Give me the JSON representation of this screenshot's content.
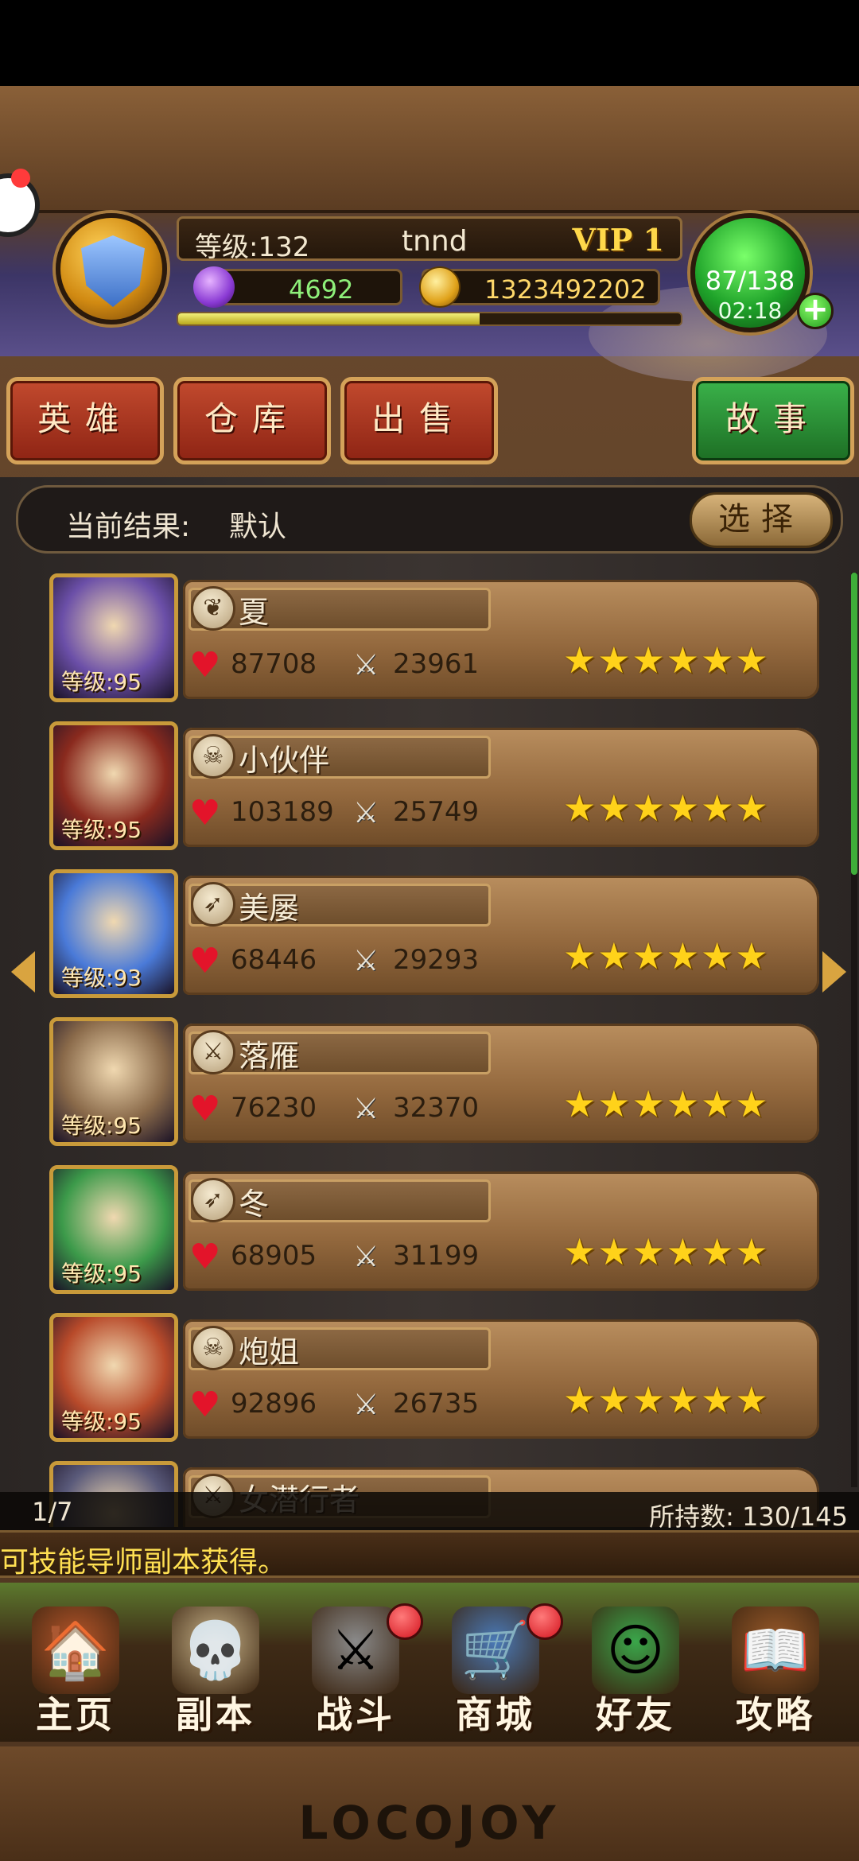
{
  "player": {
    "level_label": "等级:132",
    "name": "tnnd",
    "vip": "VIP 1",
    "gems": "4692",
    "coins": "1323492202",
    "energy": "87/138",
    "energy_timer": "02:18",
    "exp_fraction": 0.6
  },
  "tabs": {
    "heroes": "英雄",
    "warehouse": "仓库",
    "sell": "出售",
    "story": "故事"
  },
  "filter": {
    "label": "当前结果:",
    "value": "默认",
    "select_button": "选择"
  },
  "heroes": [
    {
      "name": "夏",
      "level": "等级:95",
      "hp": "87708",
      "atk": "23961",
      "stars": "★★★★★★",
      "class_icon": "leaf-icon",
      "portrait_color": "#6b4fa8"
    },
    {
      "name": "小伙伴",
      "level": "等级:95",
      "hp": "103189",
      "atk": "25749",
      "stars": "★★★★★★",
      "class_icon": "skull-icon",
      "portrait_color": "#8a2a1e"
    },
    {
      "name": "美屡",
      "level": "等级:93",
      "hp": "68446",
      "atk": "29293",
      "stars": "★★★★★★",
      "class_icon": "bow-icon",
      "portrait_color": "#4a7ad8"
    },
    {
      "name": "落雁",
      "level": "等级:95",
      "hp": "76230",
      "atk": "32370",
      "stars": "★★★★★★",
      "class_icon": "swords-icon",
      "portrait_color": "#8a6a4a"
    },
    {
      "name": "冬",
      "level": "等级:95",
      "hp": "68905",
      "atk": "31199",
      "stars": "★★★★★★",
      "class_icon": "bow-icon",
      "portrait_color": "#3c9a4a"
    },
    {
      "name": "炮姐",
      "level": "等级:95",
      "hp": "92896",
      "atk": "26735",
      "stars": "★★★★★★",
      "class_icon": "skull-icon",
      "portrait_color": "#b84a2a"
    },
    {
      "name": "女潜行者",
      "level": "",
      "hp": "",
      "atk": "",
      "stars": "",
      "class_icon": "swords-icon",
      "portrait_color": "#5a5a7a"
    }
  ],
  "footer": {
    "page": "1/7",
    "owned": "所持数: 130/145",
    "ticker": "可技能导师副本获得。"
  },
  "nav": [
    {
      "label": "主页",
      "icon": "house-icon",
      "badge": false
    },
    {
      "label": "副本",
      "icon": "skull-icon",
      "badge": false
    },
    {
      "label": "战斗",
      "icon": "sword-icon",
      "badge": true
    },
    {
      "label": "商城",
      "icon": "shop-icon",
      "badge": true
    },
    {
      "label": "好友",
      "icon": "friends-icon",
      "badge": false
    },
    {
      "label": "攻略",
      "icon": "book-icon",
      "badge": false
    }
  ],
  "brand": "LOCOJOY"
}
